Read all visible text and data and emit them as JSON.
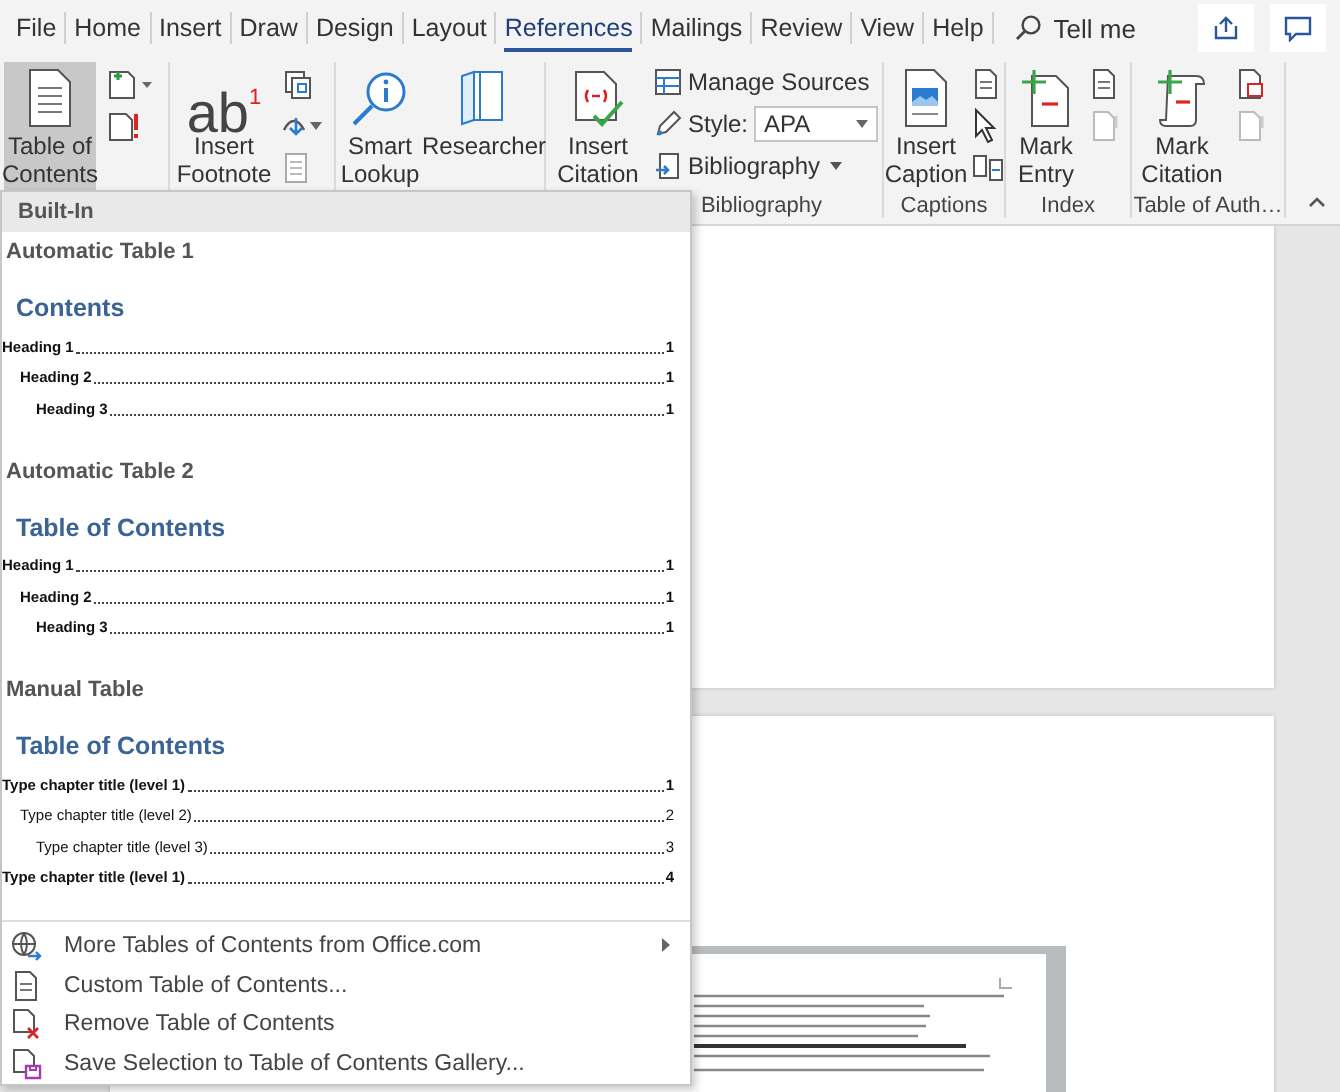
{
  "tabs": [
    {
      "label": "File",
      "selected": false
    },
    {
      "label": "Home",
      "selected": false
    },
    {
      "label": "Insert",
      "selected": false
    },
    {
      "label": "Draw",
      "selected": false
    },
    {
      "label": "Design",
      "selected": false
    },
    {
      "label": "Layout",
      "selected": false
    },
    {
      "label": "References",
      "selected": true
    },
    {
      "label": "Mailings",
      "selected": false
    },
    {
      "label": "Review",
      "selected": false
    },
    {
      "label": "View",
      "selected": false
    },
    {
      "label": "Help",
      "selected": false
    }
  ],
  "tell_me": {
    "placeholder": "Tell me"
  },
  "ribbon": {
    "table_of_contents": {
      "label": "Table of\nContents",
      "pressed": true
    },
    "insert_footnote": {
      "label": "Insert\nFootnote",
      "glyph": "ab",
      "glyph_mark": "1"
    },
    "smart_lookup": {
      "label": "Smart\nLookup"
    },
    "researcher": {
      "label": "Researcher"
    },
    "insert_citation": {
      "label": "Insert\nCitation"
    },
    "manage_sources": {
      "label": "Manage Sources"
    },
    "style": {
      "label": "Style:",
      "value": "APA"
    },
    "bibliography": {
      "label": "Bibliography"
    },
    "insert_caption": {
      "label": "Insert\nCaption"
    },
    "mark_entry": {
      "label": "Mark\nEntry"
    },
    "mark_citation": {
      "label": "Mark\nCitation"
    },
    "group_labels": [
      "Bibliography",
      "Captions",
      "Index",
      "Table of Auth…"
    ]
  },
  "menu": {
    "header": "Built-In",
    "gallery": [
      {
        "title": "Automatic Table 1",
        "heading": "Contents",
        "kind": "automatic",
        "entries": [
          {
            "text": "Heading 1",
            "page": "1",
            "children": [
              {
                "text": "Heading 2",
                "page": "1",
                "children": [
                  {
                    "text": "Heading 3",
                    "page": "1"
                  }
                ]
              }
            ]
          }
        ]
      },
      {
        "title": "Automatic Table 2",
        "heading": "Table of Contents",
        "kind": "automatic",
        "entries": [
          {
            "text": "Heading 1",
            "page": "1",
            "children": [
              {
                "text": "Heading 2",
                "page": "1",
                "children": [
                  {
                    "text": "Heading 3",
                    "page": "1"
                  }
                ]
              }
            ]
          }
        ]
      },
      {
        "title": "Manual Table",
        "heading": "Table of Contents",
        "kind": "manual",
        "entries": [
          {
            "text": "Type chapter title (level 1)",
            "page": "1",
            "children": [
              {
                "text": "Type chapter title (level 2)",
                "page": "2",
                "children": [
                  {
                    "text": "Type chapter title (level 3)",
                    "page": "3"
                  }
                ]
              }
            ]
          },
          {
            "text": "Type chapter title (level 1)",
            "page": "4"
          }
        ]
      }
    ],
    "commands": [
      {
        "label": "More Tables of Contents from Office.com",
        "submenu": true
      },
      {
        "label": "Custom Table of Contents...",
        "submenu": false
      },
      {
        "label": "Remove Table of Contents",
        "submenu": false
      },
      {
        "label": "Save Selection to Table of Contents Gallery...",
        "submenu": false
      }
    ]
  }
}
